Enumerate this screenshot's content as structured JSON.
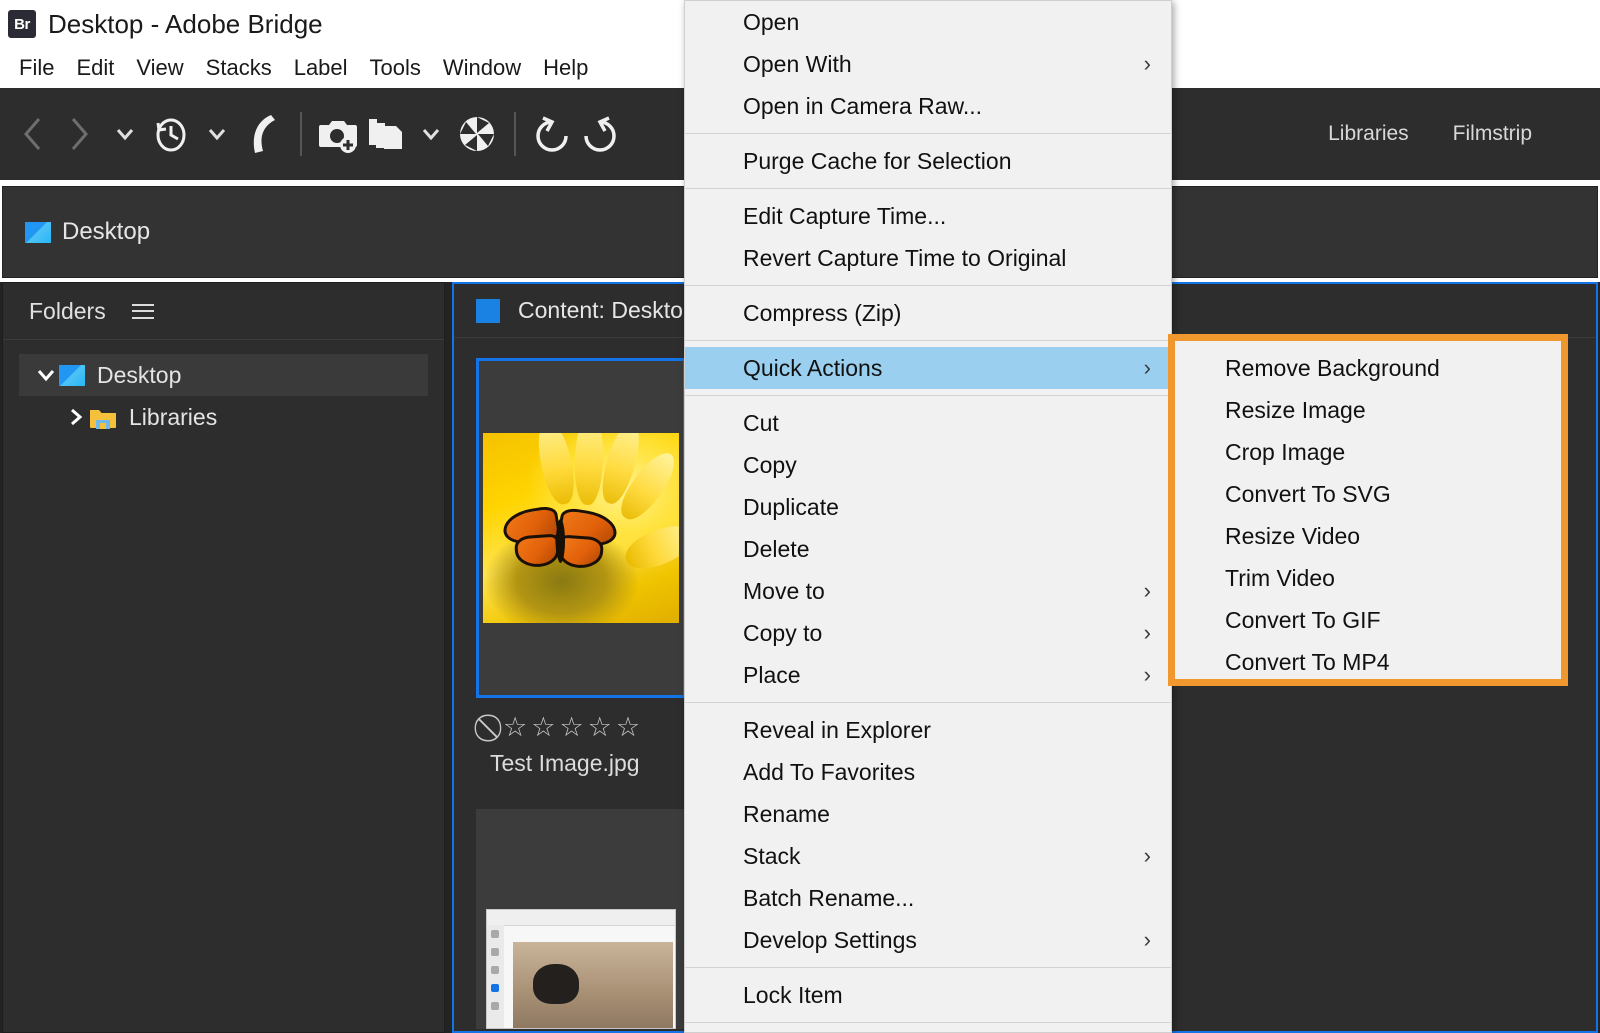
{
  "app": {
    "logo_text": "Br",
    "title": "Desktop - Adobe Bridge"
  },
  "menu_bar": {
    "items": [
      {
        "label": "File"
      },
      {
        "label": "Edit"
      },
      {
        "label": "View"
      },
      {
        "label": "Stacks"
      },
      {
        "label": "Label"
      },
      {
        "label": "Tools"
      },
      {
        "label": "Window"
      },
      {
        "label": "Help"
      }
    ]
  },
  "toolbar": {
    "icons": [
      {
        "name": "back-arrow-icon",
        "disabled": true
      },
      {
        "name": "forward-arrow-icon",
        "disabled": true
      },
      {
        "name": "chevron-down-icon",
        "disabled": false
      },
      {
        "name": "recent-history-clock-icon",
        "disabled": false
      },
      {
        "name": "recent-history-chevron-down-icon",
        "disabled": false
      },
      {
        "name": "boomerang-icon",
        "disabled": false
      },
      {
        "name": "get-photos-from-camera-icon",
        "disabled": false
      },
      {
        "name": "batch-copies-icon",
        "disabled": false
      },
      {
        "name": "batch-copies-chevron-down-icon",
        "disabled": false
      },
      {
        "name": "camera-raw-aperture-icon",
        "disabled": false
      },
      {
        "name": "rotate-counterclockwise-icon",
        "disabled": false
      },
      {
        "name": "rotate-clockwise-icon",
        "disabled": false
      }
    ],
    "workspace_tabs": [
      {
        "label": "Libraries"
      },
      {
        "label": "Filmstrip"
      }
    ]
  },
  "path_bar": {
    "icon": "desktop-icon",
    "label": "Desktop"
  },
  "folders_panel": {
    "title": "Folders",
    "menu_icon": "hamburger-menu-icon",
    "tree": [
      {
        "label": "Desktop",
        "icon": "desktop-icon",
        "expanded": true,
        "selected": true,
        "arrow": "chevron-down-icon"
      },
      {
        "label": "Libraries",
        "icon": "folder-icon",
        "expanded": false,
        "selected": false,
        "arrow": "chevron-right-icon"
      }
    ]
  },
  "content_panel": {
    "title": "Content: Desktop",
    "icon": "blue-square-icon",
    "items": [
      {
        "name": "Test Image.jpg",
        "selected": true,
        "reject_icon": "reject-icon",
        "rating": 0,
        "stars": [
          "☆",
          "☆",
          "☆",
          "☆",
          "☆"
        ],
        "reject_glyph": "⃠"
      },
      {
        "name": "",
        "selected": false
      }
    ]
  },
  "context_menu": {
    "groups": [
      {
        "items": [
          {
            "label": "Open",
            "submenu": false
          },
          {
            "label": "Open With",
            "submenu": true
          },
          {
            "label": "Open in Camera Raw...",
            "submenu": false
          }
        ]
      },
      {
        "items": [
          {
            "label": "Purge Cache for Selection",
            "submenu": false
          }
        ]
      },
      {
        "items": [
          {
            "label": "Edit Capture Time...",
            "submenu": false
          },
          {
            "label": "Revert Capture Time to Original",
            "submenu": false
          }
        ]
      },
      {
        "items": [
          {
            "label": "Compress (Zip)",
            "submenu": false
          }
        ]
      },
      {
        "items": [
          {
            "label": "Quick Actions",
            "submenu": true,
            "highlighted": true
          }
        ]
      },
      {
        "items": [
          {
            "label": "Cut",
            "submenu": false
          },
          {
            "label": "Copy",
            "submenu": false
          },
          {
            "label": "Duplicate",
            "submenu": false
          },
          {
            "label": "Delete",
            "submenu": false
          },
          {
            "label": "Move to",
            "submenu": true
          },
          {
            "label": "Copy to",
            "submenu": true
          },
          {
            "label": "Place",
            "submenu": true
          }
        ]
      },
      {
        "items": [
          {
            "label": "Reveal in Explorer",
            "submenu": false
          },
          {
            "label": "Add To Favorites",
            "submenu": false
          },
          {
            "label": "Rename",
            "submenu": false
          },
          {
            "label": "Stack",
            "submenu": true
          },
          {
            "label": "Batch Rename...",
            "submenu": false
          },
          {
            "label": "Develop Settings",
            "submenu": true
          }
        ]
      },
      {
        "items": [
          {
            "label": "Lock Item",
            "submenu": false
          }
        ]
      }
    ],
    "submenu_arrow_glyph": "›"
  },
  "quick_actions_submenu": {
    "items": [
      {
        "label": "Remove Background"
      },
      {
        "label": "Resize Image"
      },
      {
        "label": "Crop Image"
      },
      {
        "label": "Convert To SVG"
      },
      {
        "label": "Resize Video"
      },
      {
        "label": "Trim Video"
      },
      {
        "label": "Convert To GIF"
      },
      {
        "label": "Convert To MP4"
      }
    ]
  },
  "colors": {
    "annotation_orange": "#F0982D",
    "highlight_blue": "#9ACFF0",
    "panel_accent_blue": "#1473E6",
    "dark_panel": "#2D2D2D",
    "window_chrome": "#232323",
    "menu_background": "#F1F1F1"
  }
}
